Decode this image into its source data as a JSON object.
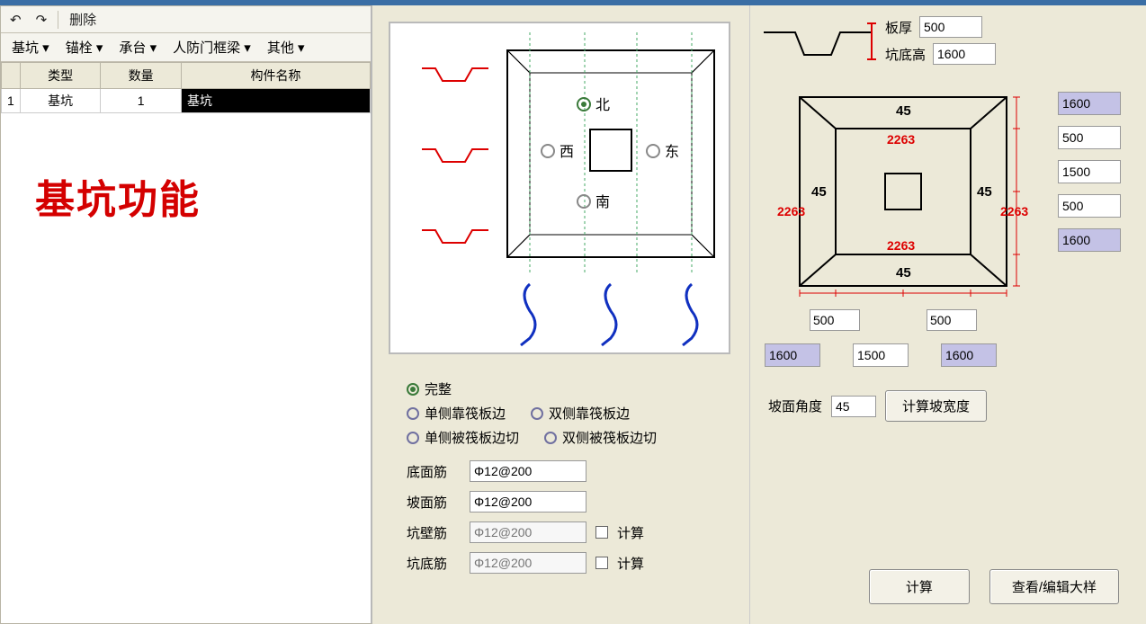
{
  "toolbar": {
    "back_icon": "↶",
    "forward_icon": "↷",
    "delete_label": "删除"
  },
  "menus": {
    "pit": "基坑 ▾",
    "anchor": "锚栓 ▾",
    "cap": "承台 ▾",
    "frame": "人防门框梁 ▾",
    "other": "其他 ▾"
  },
  "grid": {
    "headers": [
      "类型",
      "数量",
      "构件名称"
    ],
    "row": {
      "idx": "1",
      "type": "基坑",
      "count": "1",
      "name": "基坑"
    }
  },
  "big_label": "基坑功能",
  "plan": {
    "north": "北",
    "south": "南",
    "east": "东",
    "west": "西"
  },
  "shape_options": {
    "opt1": "完整",
    "opt2": "单侧靠筏板边",
    "opt3": "双侧靠筏板边",
    "opt4": "单侧被筏板边切",
    "opt5": "双侧被筏板边切"
  },
  "rebar": {
    "bottom_label": "底面筋",
    "slope_label": "坡面筋",
    "wall_label": "坑壁筋",
    "base_label": "坑底筋",
    "value": "Φ12@200",
    "placeholder": "Φ12@200",
    "calc_label": "计算"
  },
  "slab": {
    "thickness_label": "板厚",
    "thickness_value": "500",
    "depth_label": "坑底高",
    "depth_value": "1600"
  },
  "dims": {
    "angle": "45",
    "side": "2263",
    "right": [
      "1600",
      "500",
      "1500",
      "500",
      "1600"
    ],
    "bottom_inner": [
      "500",
      "500"
    ],
    "bottom_outer": [
      "1600",
      "1500",
      "1600"
    ]
  },
  "angle_row": {
    "label": "坡面角度",
    "value": "45",
    "button": "计算坡宽度"
  },
  "buttons": {
    "calc": "计算",
    "view": "查看/编辑大样"
  }
}
